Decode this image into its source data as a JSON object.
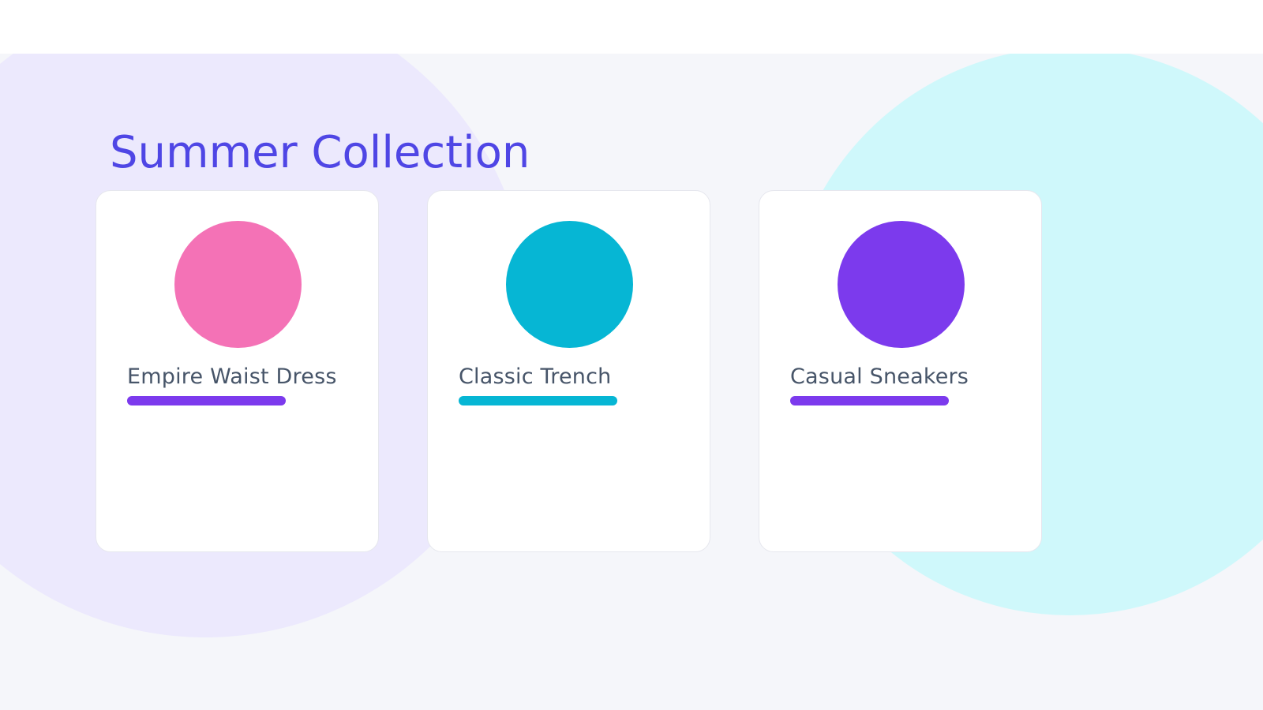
{
  "colors": {
    "title": "#4f46e5",
    "text": "#475569",
    "background": "#f5f6fa",
    "blob_left": "#ece9fd",
    "blob_right": "#cff8fb"
  },
  "page": {
    "title": "Summer Collection"
  },
  "products": [
    {
      "name": "Empire Waist Dress",
      "swatch_color": "#f472b6",
      "accent_color": "#7c3aed"
    },
    {
      "name": "Classic Trench",
      "swatch_color": "#06b6d4",
      "accent_color": "#06b6d4"
    },
    {
      "name": "Casual Sneakers",
      "swatch_color": "#7c3aed",
      "accent_color": "#7c3aed"
    }
  ]
}
